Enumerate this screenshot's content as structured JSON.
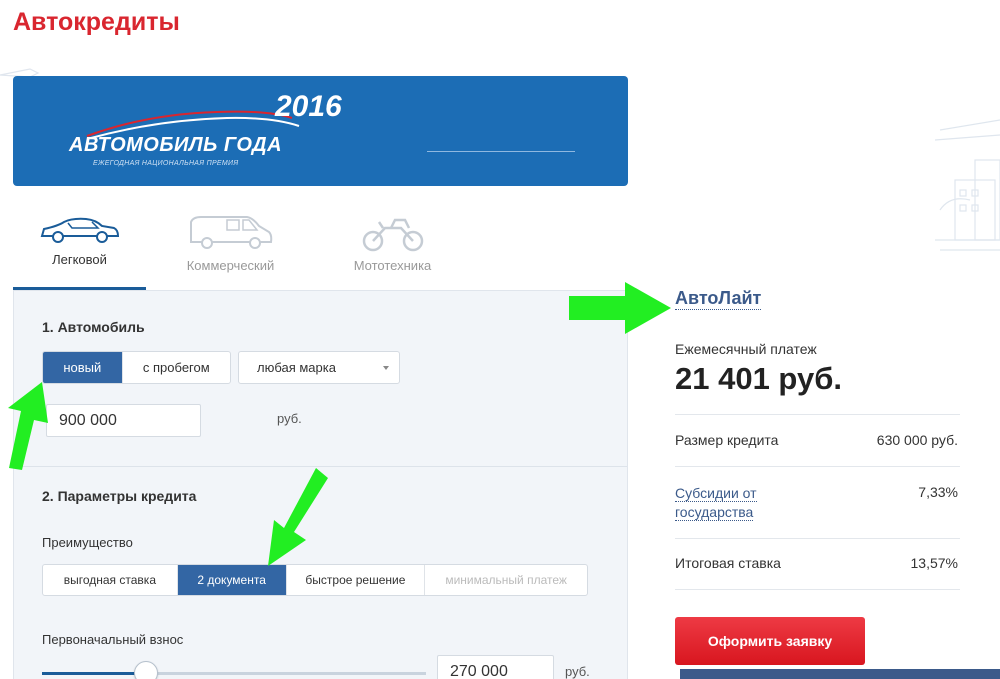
{
  "page": {
    "title": "Автокредиты"
  },
  "banner": {
    "year": "2016",
    "title": "АВТОМОБИЛЬ ГОДА",
    "subtitle": "ЕЖЕГОДНАЯ НАЦИОНАЛЬНАЯ ПРЕМИЯ"
  },
  "vehicle_tabs": [
    {
      "label": "Легковой",
      "icon": "car-icon",
      "active": true
    },
    {
      "label": "Коммерческий",
      "icon": "van-icon",
      "active": false
    },
    {
      "label": "Мототехника",
      "icon": "motorcycle-icon",
      "active": false
    }
  ],
  "section1": {
    "title": "1. Автомобиль",
    "condition_options": [
      {
        "label": "новый",
        "active": true
      },
      {
        "label": "с пробегом",
        "active": false
      }
    ],
    "brand_select": "любая марка",
    "price_value": "900 000",
    "price_unit": "руб."
  },
  "section2": {
    "title": "2. Параметры кредита",
    "advantage_label": "Преимущество",
    "advantage_options": [
      {
        "label": "выгодная ставка",
        "active": false
      },
      {
        "label": "2 документа",
        "active": true
      },
      {
        "label": "быстрое решение",
        "active": false
      },
      {
        "label": "минимальный платеж",
        "active": false,
        "disabled": true
      }
    ],
    "down_payment_label": "Первоначальный взнос",
    "down_payment_value": "270 000",
    "down_payment_unit": "руб.",
    "down_payment_fraction": 0.27
  },
  "result": {
    "product_name": "АвтоЛайт",
    "monthly_label": "Ежемесячный платеж",
    "monthly_value": "21 401 руб.",
    "rows": [
      {
        "label": "Размер кредита",
        "value": "630 000 руб.",
        "link": false
      },
      {
        "label": "Субсидии от государства",
        "value": "7,33%",
        "link": true
      },
      {
        "label": "Итоговая ставка",
        "value": "13,57%",
        "link": false
      }
    ],
    "apply_label": "Оформить заявку"
  },
  "colors": {
    "title_red": "#d9262f",
    "banner_blue": "#1c6db5",
    "active_blue": "#3366a4",
    "link_blue": "#3b5a8a",
    "apply_red": "#e8212c",
    "arrow_green": "#22ee22"
  }
}
